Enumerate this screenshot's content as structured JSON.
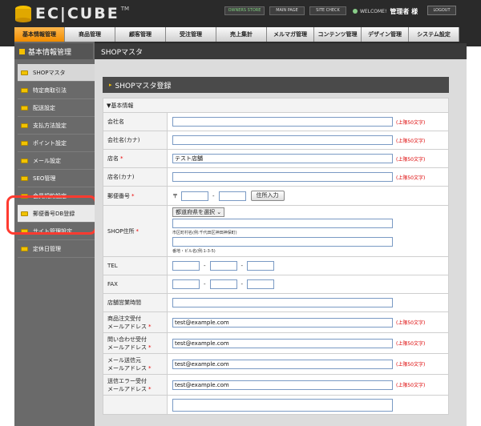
{
  "header": {
    "logo": "EC|CUBE",
    "tm": "TM",
    "owners_store": "OWNERS STORE",
    "main_page": "MAIN PAGE",
    "site_check": "SITE CHECK",
    "welcome": "WELCOME!",
    "admin_name": "管理者 様",
    "logout": "LOGOUT"
  },
  "nav": [
    {
      "label": "基本情報管理",
      "w": 64
    },
    {
      "label": "商品管理",
      "w": 64
    },
    {
      "label": "顧客管理",
      "w": 64
    },
    {
      "label": "受注管理",
      "w": 64
    },
    {
      "label": "売上集計",
      "w": 64
    },
    {
      "label": "メルマガ管理",
      "w": 60
    },
    {
      "label": "コンテンツ管理",
      "w": 60
    },
    {
      "label": "デザイン管理",
      "w": 60
    },
    {
      "label": "システム設定",
      "w": 64
    }
  ],
  "sidebar": {
    "title": "基本情報管理",
    "items": [
      "SHOPマスタ",
      "特定商取引法",
      "配送設定",
      "支払方法設定",
      "ポイント設定",
      "メール設定",
      "SEO管理",
      "会員規約設定",
      "郵便番号DB登録",
      "サイト管理設定",
      "定休日管理"
    ]
  },
  "content": {
    "header": "SHOPマスタ",
    "panel_title": "SHOPマスタ登録",
    "section": "▼基本情報",
    "limit_note": "(上限50文字)",
    "labels": {
      "company": "会社名",
      "company_kana": "会社名(カナ)",
      "shop": "店名",
      "shop_kana": "店名(カナ)",
      "zip": "郵便番号",
      "address": "SHOP住所",
      "tel": "TEL",
      "fax": "FAX",
      "hours": "店舗営業時間",
      "order_mail_1": "商品注文受付",
      "order_mail_2": "メールアドレス",
      "inquiry_mail_1": "問い合わせ受付",
      "inquiry_mail_2": "メールアドレス",
      "sender_mail_1": "メール送信元",
      "sender_mail_2": "メールアドレス",
      "error_mail_1": "送信エラー受付",
      "error_mail_2": "メールアドレス"
    },
    "values": {
      "shop": "テスト店舗",
      "email": "test@example.com"
    },
    "zip_prefix": "〒",
    "zip_button": "住所入力",
    "pref_select": "都道府県を選択",
    "addr_note_1": "市区町村名(例:千代田区神田神保町)",
    "addr_note_2": "番地・ビル名(例:1-3-5)",
    "required": "*"
  }
}
